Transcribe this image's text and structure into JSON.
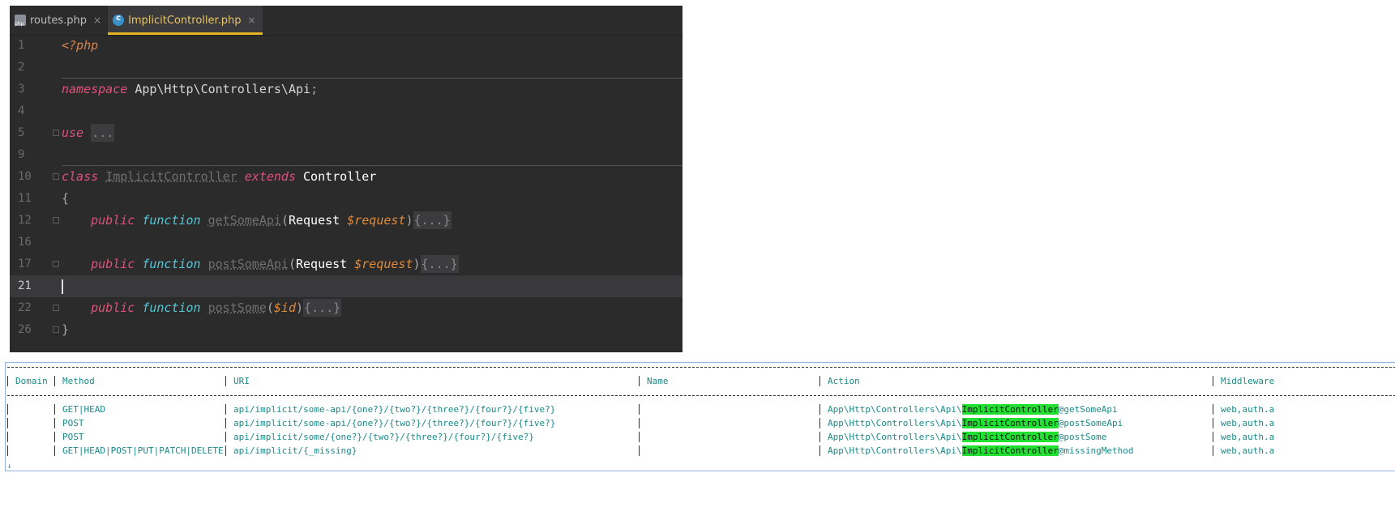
{
  "tabs": [
    {
      "label": "routes.php",
      "icon": "php-file-icon",
      "active": false
    },
    {
      "label": "ImplicitController.php",
      "icon": "class-file-icon",
      "active": true
    }
  ],
  "editor": {
    "line_numbers": [
      "1",
      "2",
      "3",
      "4",
      "5",
      "9",
      "10",
      "11",
      "12",
      "16",
      "17",
      "21",
      "22",
      "26"
    ],
    "namespace_kw": "namespace",
    "namespace_path": "App\\Http\\Controllers\\Api",
    "use_kw": "use",
    "folded": "...",
    "folded_braces": "{...}",
    "class_kw": "class",
    "class_name": "ImplicitController",
    "extends_kw": "extends",
    "parent_class": "Controller",
    "public_kw": "public",
    "function_kw": "function",
    "methods": [
      {
        "name": "getSomeApi",
        "type": "Request",
        "param": "$request"
      },
      {
        "name": "postSomeApi",
        "type": "Request",
        "param": "$request"
      },
      {
        "name": "postSome",
        "type": "",
        "param": "$id"
      }
    ],
    "php_open": "<?php"
  },
  "routes": {
    "headers": [
      "Domain",
      "Method",
      "URI",
      "Name",
      "Action",
      "Middleware"
    ],
    "action_prefix": "App\\Http\\Controllers\\Api\\",
    "highlight": "ImplicitController",
    "rows": [
      {
        "domain": "",
        "method": "GET|HEAD",
        "uri": "api/implicit/some-api/{one?}/{two?}/{three?}/{four?}/{five?}",
        "name": "",
        "action_suffix": "@getSomeApi",
        "middleware": "web,auth.a"
      },
      {
        "domain": "",
        "method": "POST",
        "uri": "api/implicit/some-api/{one?}/{two?}/{three?}/{four?}/{five?}",
        "name": "",
        "action_suffix": "@postSomeApi",
        "middleware": "web,auth.a"
      },
      {
        "domain": "",
        "method": "POST",
        "uri": "api/implicit/some/{one?}/{two?}/{three?}/{four?}/{five?}",
        "name": "",
        "action_suffix": "@postSome",
        "middleware": "web,auth.a"
      },
      {
        "domain": "",
        "method": "GET|HEAD|POST|PUT|PATCH|DELETE",
        "uri": "api/implicit/{_missing}",
        "name": "",
        "action_suffix": "@missingMethod",
        "middleware": "web,auth.a"
      }
    ]
  }
}
